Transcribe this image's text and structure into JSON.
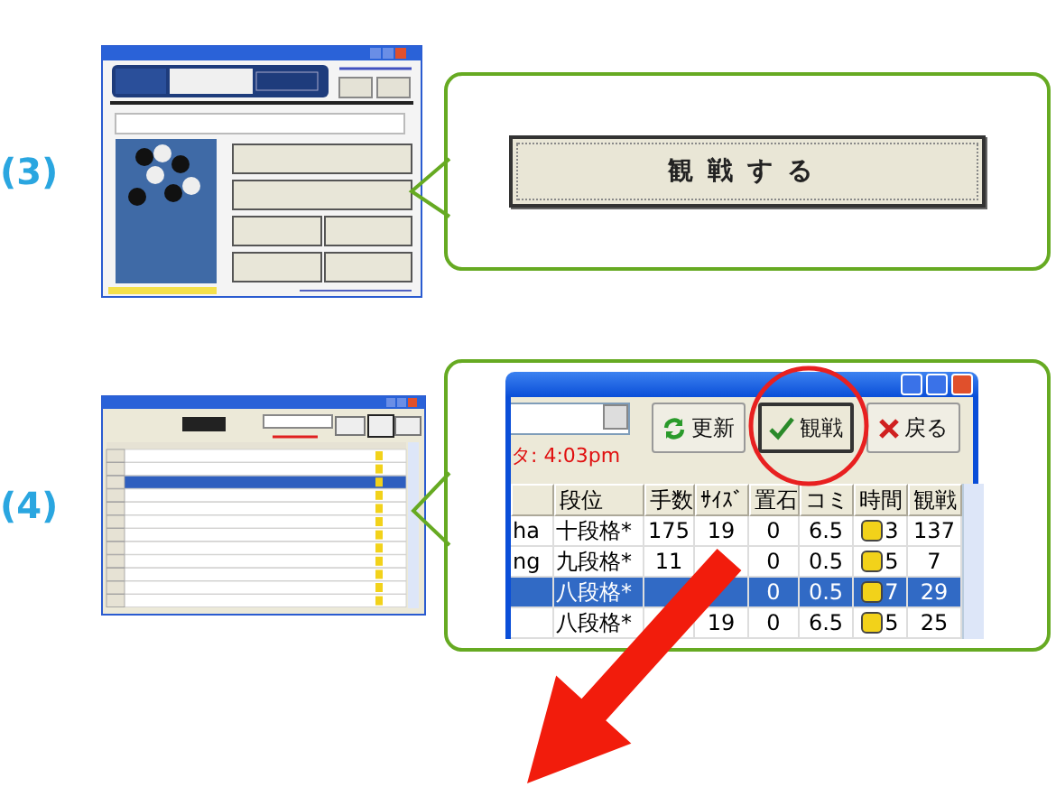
{
  "steps": [
    {
      "label": "(3)",
      "thumbnail": {
        "kind": "menu"
      },
      "callout": {
        "kind": "button",
        "button": "観戦する"
      }
    },
    {
      "label": "(4)",
      "thumbnail": {
        "kind": "table"
      },
      "callout": {
        "kind": "window",
        "data_time": "タ: 4:03pm",
        "toolbar": [
          {
            "label": "更新",
            "selected": false
          },
          {
            "label": "観戦",
            "selected": true
          },
          {
            "label": "戻る",
            "selected": false
          }
        ],
        "columns": [
          "段位",
          "手数",
          "ｻｲｽﾞ",
          "置石",
          "コミ",
          "時間",
          "観戦"
        ],
        "rows": [
          {
            "player": "ha",
            "cells": [
              "十段格*",
              "175",
              "19",
              "0",
              "6.5",
              "3",
              "137"
            ],
            "selected": false
          },
          {
            "player": "ng",
            "cells": [
              "九段格*",
              "11",
              null,
              "0",
              "0.5",
              "5",
              "7"
            ],
            "selected": false
          },
          {
            "player": null,
            "cells": [
              "八段格*",
              null,
              null,
              "0",
              "0.5",
              "7",
              "29"
            ],
            "selected": true
          },
          {
            "player": null,
            "cells": [
              "八段格*",
              null,
              "19",
              "0",
              "6.5",
              "5",
              "25"
            ],
            "selected": false
          }
        ]
      }
    }
  ]
}
